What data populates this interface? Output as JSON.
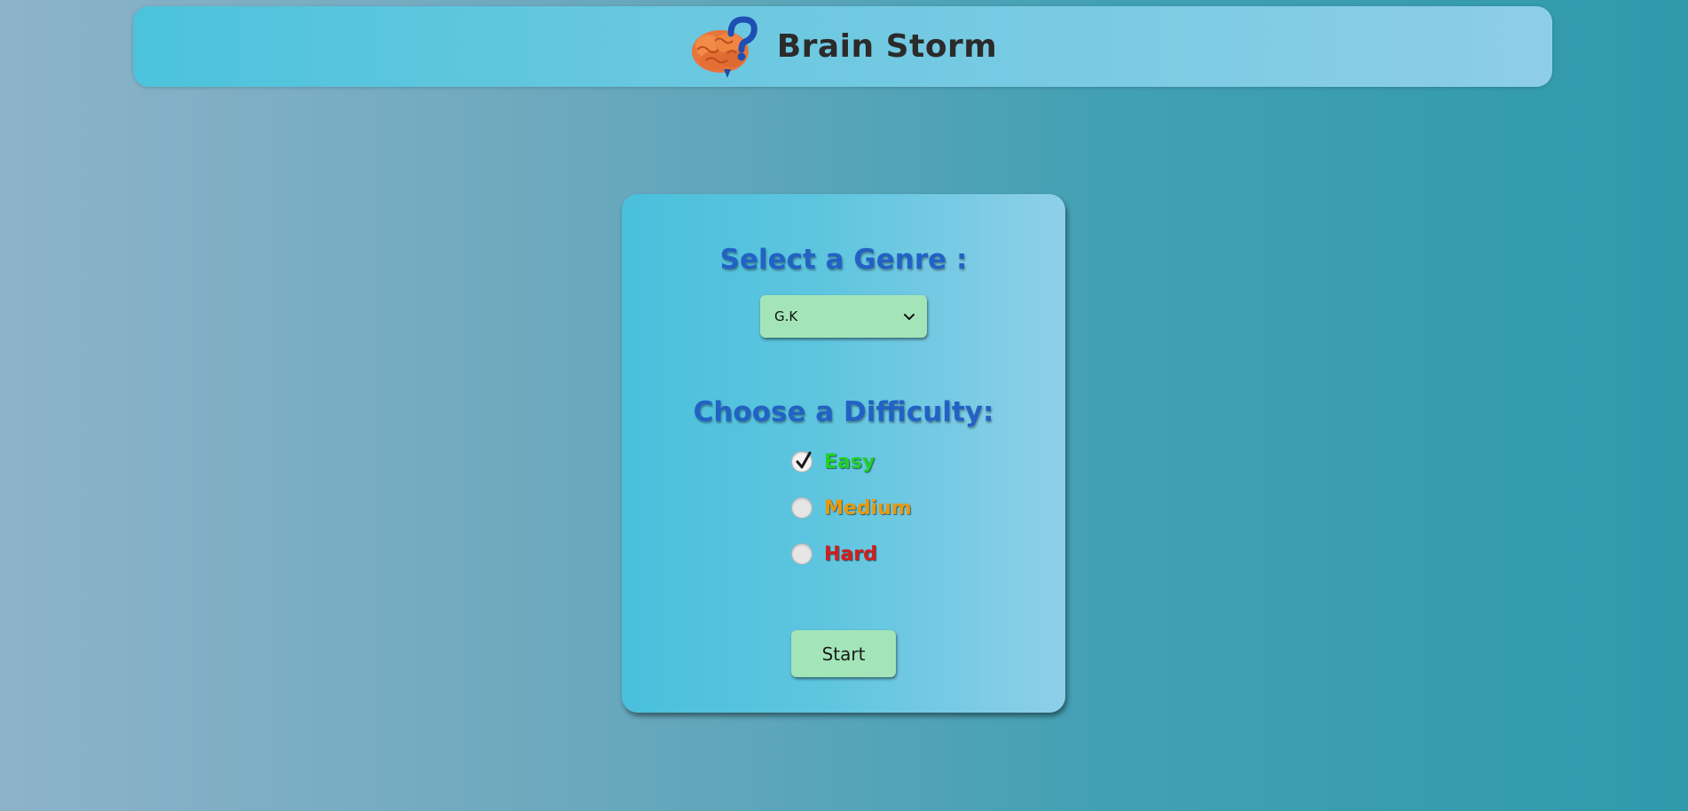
{
  "header": {
    "title": "Brain Storm",
    "logo_icon": "brain-question-icon"
  },
  "card": {
    "genre_heading": "Select a Genre :",
    "genre_select": {
      "value": "G.K"
    },
    "difficulty_heading": "Choose a Difficulty:",
    "difficulty_options": [
      {
        "label": "Easy",
        "checked": true,
        "color": "#1fd12b"
      },
      {
        "label": "Medium",
        "checked": false,
        "color": "#e69a12"
      },
      {
        "label": "Hard",
        "checked": false,
        "color": "#d21e1e"
      }
    ],
    "start_label": "Start"
  },
  "colors": {
    "heading": "#2262c4",
    "button_bg": "#a3e5b8",
    "title": "#2b2b2b"
  }
}
